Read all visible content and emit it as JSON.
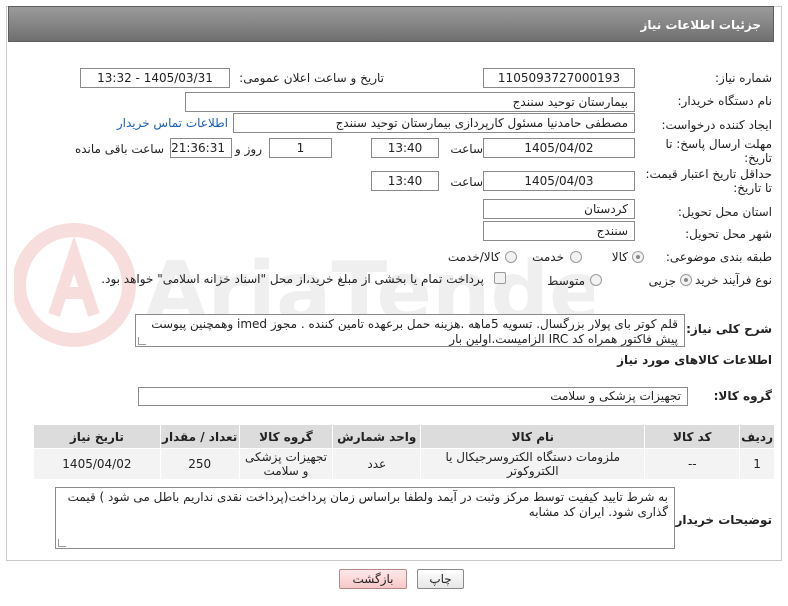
{
  "header": {
    "title": "جزئیات اطلاعات نیاز"
  },
  "fields": {
    "need_number_label": "شماره نیاز:",
    "need_number": "1105093727000193",
    "announce_label": "تاریخ و ساعت اعلان عمومی:",
    "announce_value": "1405/03/31 - 13:32",
    "buyer_org_label": "نام دستگاه خریدار:",
    "buyer_org": "بیمارستان توحید سنندج",
    "creator_label": "ایجاد کننده درخواست:",
    "creator": "مصطفی حامدنیا مسئول کارپردازی بیمارستان توحید سنندج",
    "contact_link": "اطلاعات تماس خریدار",
    "deadline_label_1": "مهلت ارسال پاسخ: تا",
    "deadline_label_2": "تاریخ:",
    "deadline_date": "1405/04/02",
    "time_label": "ساعت",
    "deadline_time": "13:40",
    "days_value": "1",
    "days_label": "روز و",
    "remaining_time": "21:36:31",
    "remaining_label": "ساعت باقی مانده",
    "validity_label_1": "حداقل تاریخ اعتبار قیمت:",
    "validity_label_2": "تا تاریخ:",
    "validity_date": "1405/04/03",
    "validity_time": "13:40",
    "province_label": "استان محل تحویل:",
    "province": "کردستان",
    "city_label": "شهر محل تحویل:",
    "city": "سنندج",
    "category_label": "طبقه بندی موضوعی:",
    "category_options": [
      "کالا",
      "خدمت",
      "کالا/خدمت"
    ],
    "process_label": "نوع فرآیند خرید :",
    "process_options": [
      "جزیی",
      "متوسط"
    ],
    "payment_note": "پرداخت تمام یا بخشی از مبلغ خرید،از محل \"اسناد خزانه اسلامی\" خواهد بود."
  },
  "summary": {
    "label": "شرح کلی نیاز:",
    "text": "قلم کوتر  بای پولار بزرگسال. تسویه 5ماهه .هزینه حمل برعهده تامین کننده . مجوز imed وهمچنین پیوست پیش فاکتور همراه کد IRC  الزامیست.اولین بار"
  },
  "goods": {
    "section_title": "اطلاعات کالاهای مورد نیاز",
    "group_label": "گروه کالا:",
    "group_value": "تجهیزات پزشکی و سلامت",
    "columns": [
      "ردیف",
      "کد کالا",
      "نام کالا",
      "واحد شمارش",
      "گروه کالا",
      "تعداد / مقدار",
      "تاریخ نیاز"
    ],
    "rows": [
      [
        "1",
        "--",
        "ملزومات دستگاه الکتروسرجیکال یا الکتروکوتر",
        "عدد",
        "تجهیزات پزشکی و سلامت",
        "250",
        "1405/04/02"
      ]
    ]
  },
  "buyer_notes": {
    "label": "توضیحات خریدار:",
    "text": "به شرط تایید کیفیت توسط مرکز وثبت در آیمد ولطفا براساس زمان پرداخت(پرداخت نقدی نداریم باطل می شود )  قیمت گذاری شود. ایران کد مشابه"
  },
  "buttons": {
    "print": "چاپ",
    "back": "بازگشت"
  },
  "watermark": {
    "text": "AriaTender.net"
  }
}
